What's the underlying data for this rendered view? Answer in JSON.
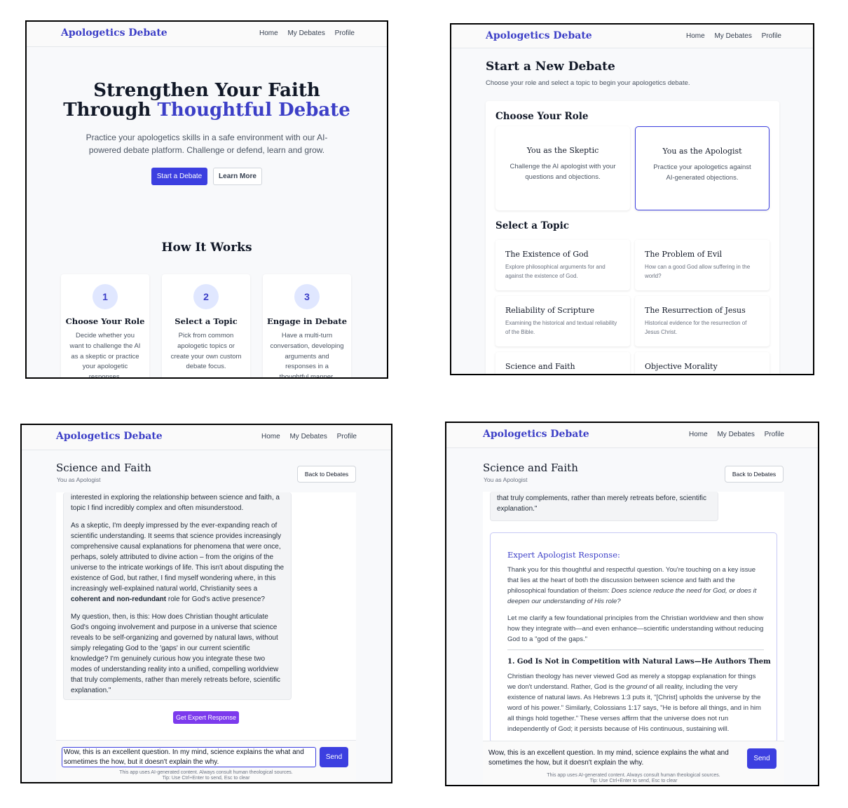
{
  "brand": "Apologetics Debate",
  "nav": {
    "home": "Home",
    "debates": "My Debates",
    "profile": "Profile"
  },
  "landing": {
    "title_line1": "Strengthen Your Faith",
    "title_line2_plain": "Through ",
    "title_line2_accent": "Thoughtful Debate",
    "subtitle": "Practice your apologetics skills in a safe environment with our AI-powered debate platform. Challenge or defend, learn and grow.",
    "start_button": "Start a Debate",
    "learn_button": "Learn More",
    "how_title": "How It Works",
    "steps": [
      {
        "num": "1",
        "title": "Choose Your Role",
        "desc": "Decide whether you want to challenge the AI as a skeptic or practice your apologetic responses."
      },
      {
        "num": "2",
        "title": "Select a Topic",
        "desc": "Pick from common apologetic topics or create your own custom debate focus."
      },
      {
        "num": "3",
        "title": "Engage in Debate",
        "desc": "Have a multi-turn conversation, developing arguments and responses in a thoughtful manner."
      }
    ]
  },
  "new_debate": {
    "title": "Start a New Debate",
    "subtitle": "Choose your role and select a topic to begin your apologetics debate.",
    "role_heading": "Choose Your Role",
    "roles": [
      {
        "title": "You as the Skeptic",
        "desc": "Challenge the AI apologist with your questions and objections."
      },
      {
        "title": "You as the Apologist",
        "desc": "Practice your apologetics against AI-generated objections."
      }
    ],
    "topic_heading": "Select a Topic",
    "topics": [
      {
        "title": "The Existence of God",
        "desc": "Explore philosophical arguments for and against the existence of God."
      },
      {
        "title": "The Problem of Evil",
        "desc": "How can a good God allow suffering in the world?"
      },
      {
        "title": "Reliability of Scripture",
        "desc": "Examining the historical and textual reliability of the Bible."
      },
      {
        "title": "The Resurrection of Jesus",
        "desc": "Historical evidence for the resurrection of Jesus Christ."
      },
      {
        "title": "Science and Faith",
        "desc": ""
      },
      {
        "title": "Objective Morality",
        "desc": ""
      }
    ]
  },
  "debate": {
    "title": "Science and Faith",
    "role": "You as Apologist",
    "back": "Back to Debates",
    "msg_p1": "interested in exploring the relationship between science and faith, a topic I find incredibly complex and often misunderstood.",
    "msg_p2a": "As a skeptic, I'm deeply impressed by the ever-expanding reach of scientific understanding. It seems that science provides increasingly comprehensive causal explanations for phenomena that were once, perhaps, solely attributed to divine action – from the origins of the universe to the intricate workings of life. This isn't about disputing the existence of God, but rather, I find myself wondering where, in this increasingly well-explained natural world, Christianity sees a ",
    "msg_p2_bold": "coherent and non-redundant",
    "msg_p2b": " role for God's active presence?",
    "msg_p3": "My question, then, is this: How does Christian thought articulate God's ongoing involvement and purpose in a universe that science reveals to be self-organizing and governed by natural laws, without simply relegating God to the 'gaps' in our current scientific knowledge? I'm genuinely curious how you integrate these two modes of understanding reality into a unified, compelling worldview that truly complements, rather than merely retreats before, scientific explanation.\"",
    "msg_tail": "that truly complements, rather than merely retreats before, scientific explanation.\"",
    "expert_button": "Get Expert Response",
    "input_value": "Wow, this is an excellent question. In my mind, science explains the what and sometimes the how, but it doesn't explain the why.",
    "send": "Send",
    "footer1": "This app uses AI-generated content. Always consult human theological sources.",
    "footer2": "Tip: Use Ctrl+Enter to send, Esc to clear",
    "expert_heading": "Expert Apologist Response:",
    "expert_p1a": "Thank you for this thoughtful and respectful question. You're touching on a key issue that lies at the heart of both the discussion between science and faith and the philosophical foundation of theism: ",
    "expert_p1_italic": "Does science reduce the need for God, or does it deepen our understanding of His role?",
    "expert_p2": "Let me clarify a few foundational principles from the Christian worldview and then show how they integrate with—and even enhance—scientific understanding without reducing God to a \"god of the gaps.\"",
    "expert_sec1": "1. God Is Not in Competition with Natural Laws—He Authors Them",
    "expert_p3a": "Christian theology has never viewed God as merely a stopgap explanation for things we don't understand. Rather, God is the ",
    "expert_p3_italic": "ground",
    "expert_p3b": " of all reality, including the very existence of natural laws. As Hebrews 1:3 puts it, \"[Christ] upholds the universe by the word of his power.\" Similarly, Colossians 1:17 says, \"He is before all things, and in him all things hold together.\" These verses affirm that the universe does not run independently of God; it persists because of His continuous, sustaining will."
  }
}
